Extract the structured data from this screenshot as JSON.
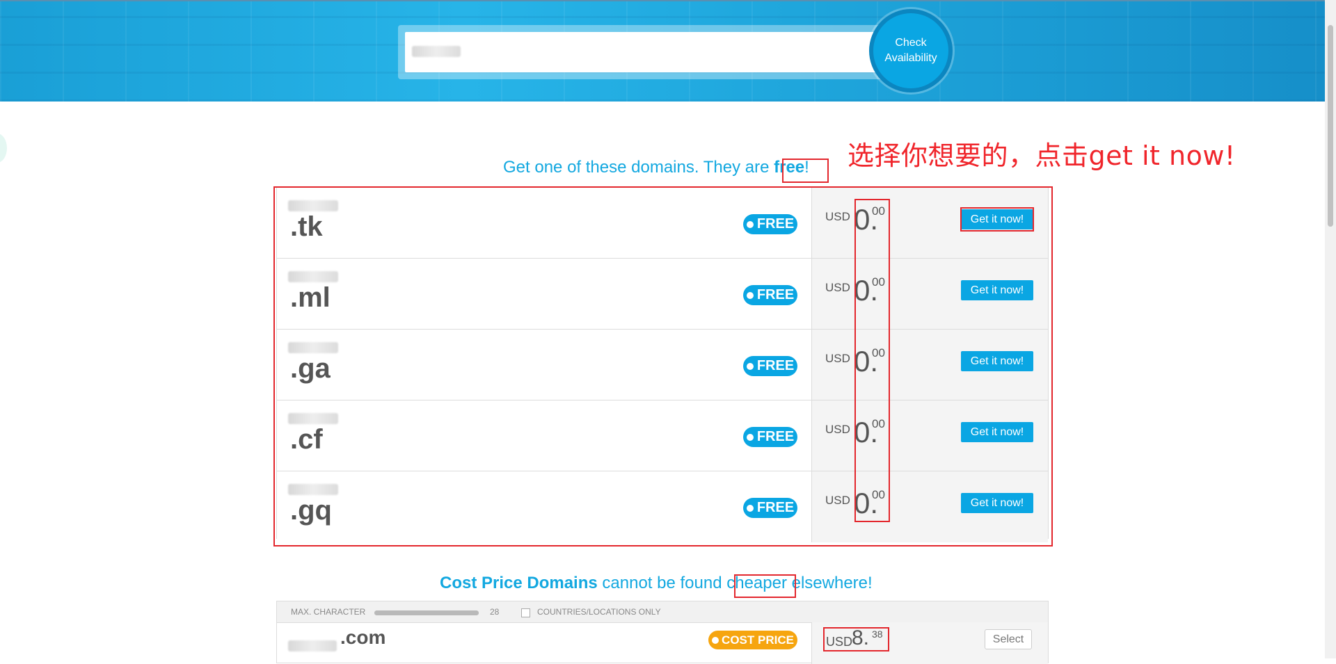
{
  "search": {
    "placeholder": "",
    "button_label": "Check Availability"
  },
  "annotation": {
    "instruction": "选择你想要的，点击get it now!"
  },
  "free_section": {
    "title_prefix": "Get one of these domains. They are ",
    "title_highlight": "free",
    "title_suffix": "!",
    "rows": [
      {
        "tld": ".tk",
        "badge": "FREE",
        "currency": "USD",
        "price_int": "0.",
        "price_dec": "00",
        "button": "Get it now!"
      },
      {
        "tld": ".ml",
        "badge": "FREE",
        "currency": "USD",
        "price_int": "0.",
        "price_dec": "00",
        "button": "Get it now!"
      },
      {
        "tld": ".ga",
        "badge": "FREE",
        "currency": "USD",
        "price_int": "0.",
        "price_dec": "00",
        "button": "Get it now!"
      },
      {
        "tld": ".cf",
        "badge": "FREE",
        "currency": "USD",
        "price_int": "0.",
        "price_dec": "00",
        "button": "Get it now!"
      },
      {
        "tld": ".gq",
        "badge": "FREE",
        "currency": "USD",
        "price_int": "0.",
        "price_dec": "00",
        "button": "Get it now!"
      }
    ]
  },
  "cost_section": {
    "title_strong": "Cost Price Domains",
    "title_mid": " cannot be found ",
    "title_highlight": "cheaper",
    "title_suffix": " elsewhere!",
    "filter": {
      "max_char_label": "MAX. CHARACTER",
      "max_char_value": "28",
      "slider_fraction": 1.0,
      "countries_label": "COUNTRIES/LOCATIONS ONLY"
    },
    "rows": [
      {
        "tld": ".com",
        "badge": "COST PRICE",
        "currency": "USD",
        "price_int": "8.",
        "price_dec": "38",
        "button": "Select"
      }
    ]
  },
  "colors": {
    "accent": "#0aa6e3",
    "annotation_red": "#e3262c",
    "cost_badge": "#f6a50f"
  }
}
